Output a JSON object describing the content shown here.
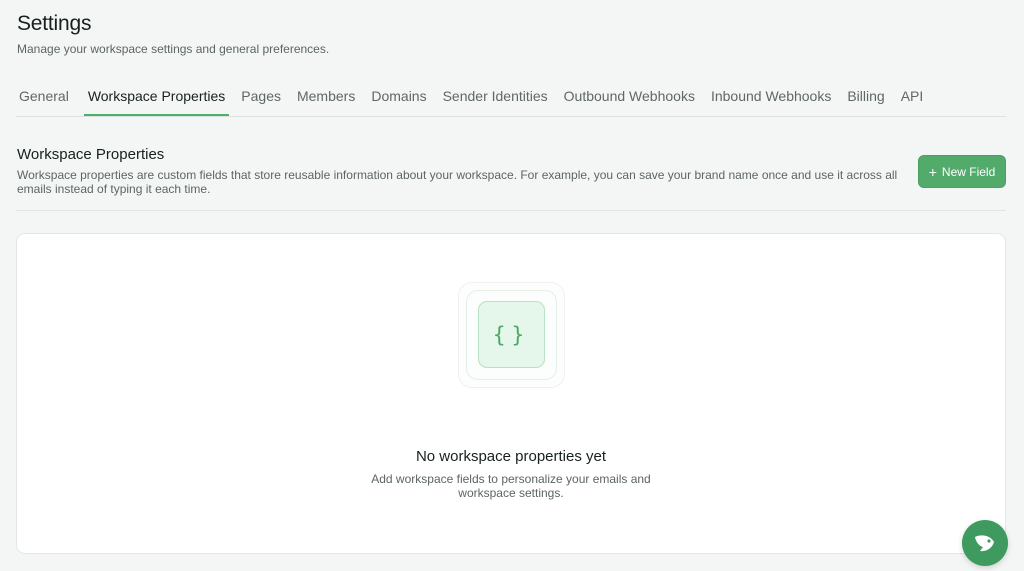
{
  "header": {
    "title": "Settings",
    "subtitle": "Manage your workspace settings and general preferences."
  },
  "tabs": [
    {
      "label": "General",
      "active": false
    },
    {
      "label": "Workspace Properties",
      "active": true
    },
    {
      "label": "Pages",
      "active": false
    },
    {
      "label": "Members",
      "active": false
    },
    {
      "label": "Domains",
      "active": false
    },
    {
      "label": "Sender Identities",
      "active": false
    },
    {
      "label": "Outbound Webhooks",
      "active": false
    },
    {
      "label": "Inbound Webhooks",
      "active": false
    },
    {
      "label": "Billing",
      "active": false
    },
    {
      "label": "API",
      "active": false
    }
  ],
  "section": {
    "title": "Workspace Properties",
    "description": "Workspace properties are custom fields that store reusable information about your workspace. For example, you can save your brand name once and use it across all emails instead of typing it each time.",
    "new_button": {
      "icon": "plus-icon",
      "label": "New Field"
    }
  },
  "empty_state": {
    "icon": "braces-icon",
    "glyph": "{}",
    "title": "No workspace properties yet",
    "description_line1": "Add workspace fields to personalize your emails and",
    "description_line2": "workspace settings."
  },
  "chat_launcher": {
    "icon": "bird-chat-icon"
  },
  "colors": {
    "accent": "#52ab6b",
    "accent_light": "#e5f6ea",
    "background": "#f4f6f5",
    "text_primary": "#17211b",
    "text_secondary": "#5c6660"
  }
}
